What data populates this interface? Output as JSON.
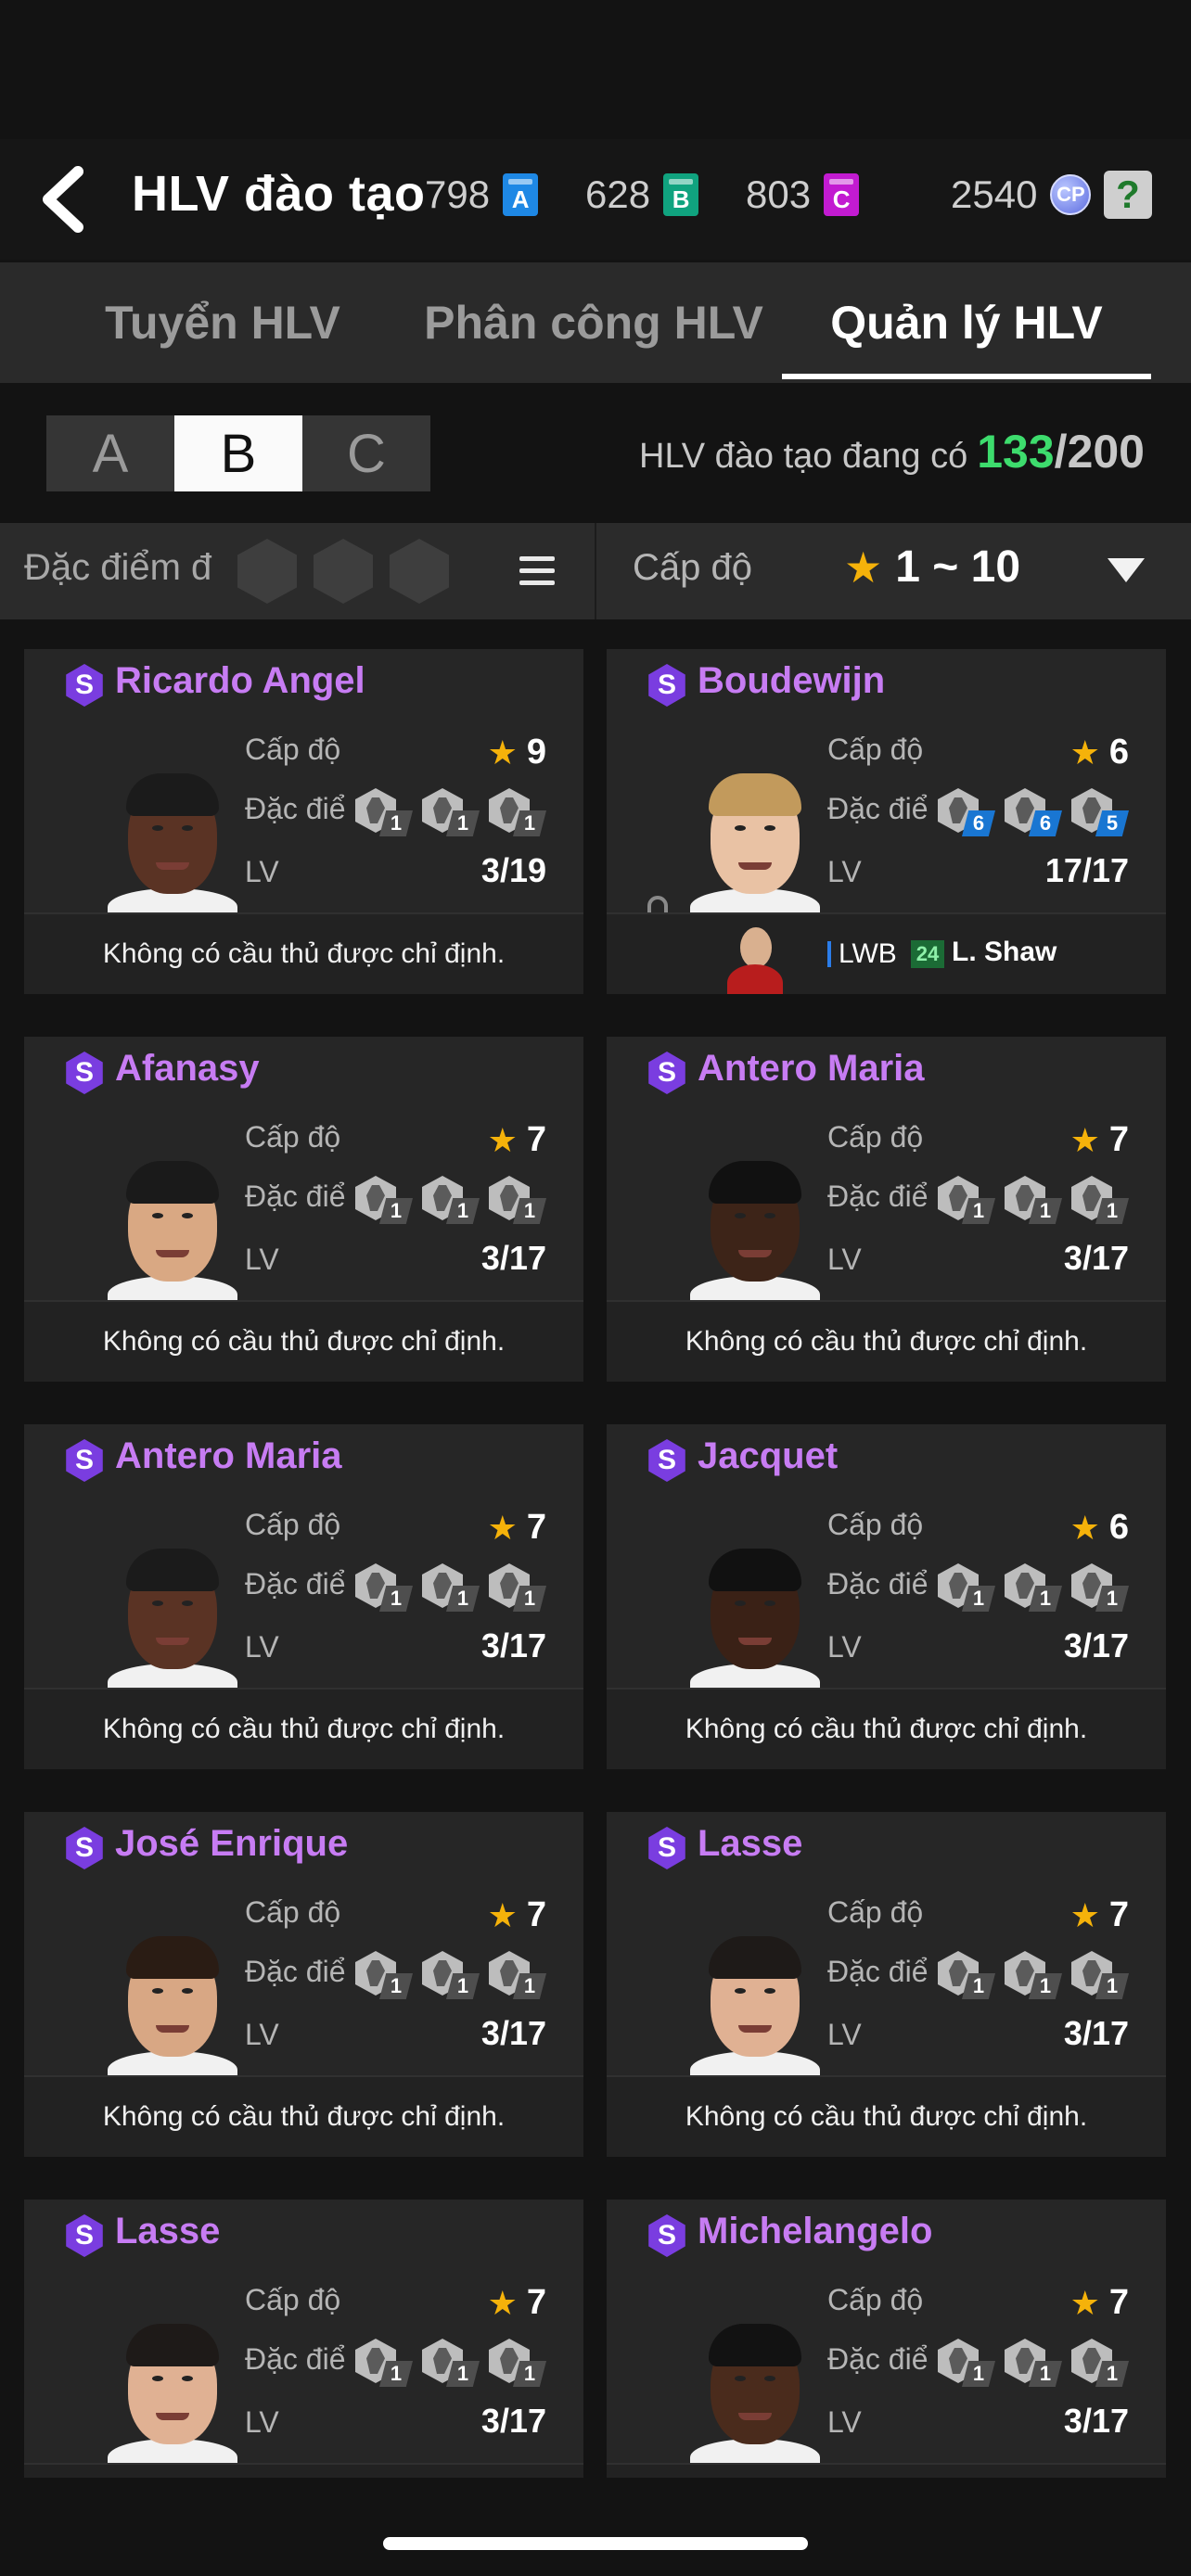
{
  "header": {
    "title": "HLV đào tạo",
    "currencies": [
      {
        "value": "798",
        "letter": "A",
        "color": "#1e88e5"
      },
      {
        "value": "628",
        "letter": "B",
        "color": "#10a37f"
      },
      {
        "value": "803",
        "letter": "C",
        "color": "#c21bd1"
      }
    ],
    "cp_value": "2540",
    "cp_label": "CP",
    "help_label": "?"
  },
  "tabs": [
    {
      "label": "Tuyển HLV",
      "active": false
    },
    {
      "label": "Phân công  HLV",
      "active": false
    },
    {
      "label": "Quản lý HLV",
      "active": true
    }
  ],
  "segments": [
    {
      "label": "A",
      "active": false
    },
    {
      "label": "B",
      "active": true
    },
    {
      "label": "C",
      "active": false
    }
  ],
  "availability": {
    "label": "HLV đào tạo đang có",
    "current": "133",
    "max": "/200",
    "current_color": "#3ddc6d"
  },
  "filter": {
    "trait_label": "Đặc điểm đ",
    "level_label": "Cấp độ",
    "level_range": "1 ~ 10"
  },
  "labels": {
    "level": "Cấp độ",
    "traits": "Đặc điểm",
    "lv": "LV",
    "no_player": "Không có cầu thủ được chỉ định."
  },
  "coaches": [
    {
      "grade": "S",
      "name": "Ricardo Angel",
      "stars": "9",
      "lv": "3/19",
      "traits": [
        "1",
        "1",
        "1"
      ],
      "trait_blue": false,
      "skin": "#5a3324",
      "hair": "#1b1b1b",
      "assigned": false
    },
    {
      "grade": "S",
      "name": "Boudewijn",
      "stars": "6",
      "lv": "17/17",
      "traits": [
        "6",
        "6",
        "5"
      ],
      "trait_blue": true,
      "skin": "#e9c2a4",
      "hair": "#c29a5c",
      "assigned": true,
      "assignment": {
        "position": "LWB",
        "ovr": "24",
        "player": "L. Shaw"
      }
    },
    {
      "grade": "S",
      "name": "Afanasy",
      "stars": "7",
      "lv": "3/17",
      "traits": [
        "1",
        "1",
        "1"
      ],
      "trait_blue": false,
      "skin": "#d9a883",
      "hair": "#1a1a1a",
      "assigned": false
    },
    {
      "grade": "S",
      "name": "Antero Maria",
      "stars": "7",
      "lv": "3/17",
      "traits": [
        "1",
        "1",
        "1"
      ],
      "trait_blue": false,
      "skin": "#3d2418",
      "hair": "#111111",
      "assigned": false
    },
    {
      "grade": "S",
      "name": "Antero Maria",
      "stars": "7",
      "lv": "3/17",
      "traits": [
        "1",
        "1",
        "1"
      ],
      "trait_blue": false,
      "skin": "#5a3324",
      "hair": "#1b1b1b",
      "assigned": false
    },
    {
      "grade": "S",
      "name": "Jacquet",
      "stars": "6",
      "lv": "3/17",
      "traits": [
        "1",
        "1",
        "1"
      ],
      "trait_blue": false,
      "skin": "#3a2116",
      "hair": "#111111",
      "assigned": false
    },
    {
      "grade": "S",
      "name": "José Enrique",
      "stars": "7",
      "lv": "3/17",
      "traits": [
        "1",
        "1",
        "1"
      ],
      "trait_blue": false,
      "skin": "#d8a784",
      "hair": "#2a1c14",
      "assigned": false
    },
    {
      "grade": "S",
      "name": "Lasse",
      "stars": "7",
      "lv": "3/17",
      "traits": [
        "1",
        "1",
        "1"
      ],
      "trait_blue": false,
      "skin": "#e0b193",
      "hair": "#1e1a18",
      "assigned": false
    },
    {
      "grade": "S",
      "name": "Lasse",
      "stars": "7",
      "lv": "3/17",
      "traits": [
        "1",
        "1",
        "1"
      ],
      "trait_blue": false,
      "skin": "#e0b193",
      "hair": "#1e1a18",
      "assigned": false
    },
    {
      "grade": "S",
      "name": "Michelangelo",
      "stars": "7",
      "lv": "3/17",
      "traits": [
        "1",
        "1",
        "1"
      ],
      "trait_blue": false,
      "skin": "#4a2b1c",
      "hair": "#121212",
      "assigned": false
    }
  ]
}
